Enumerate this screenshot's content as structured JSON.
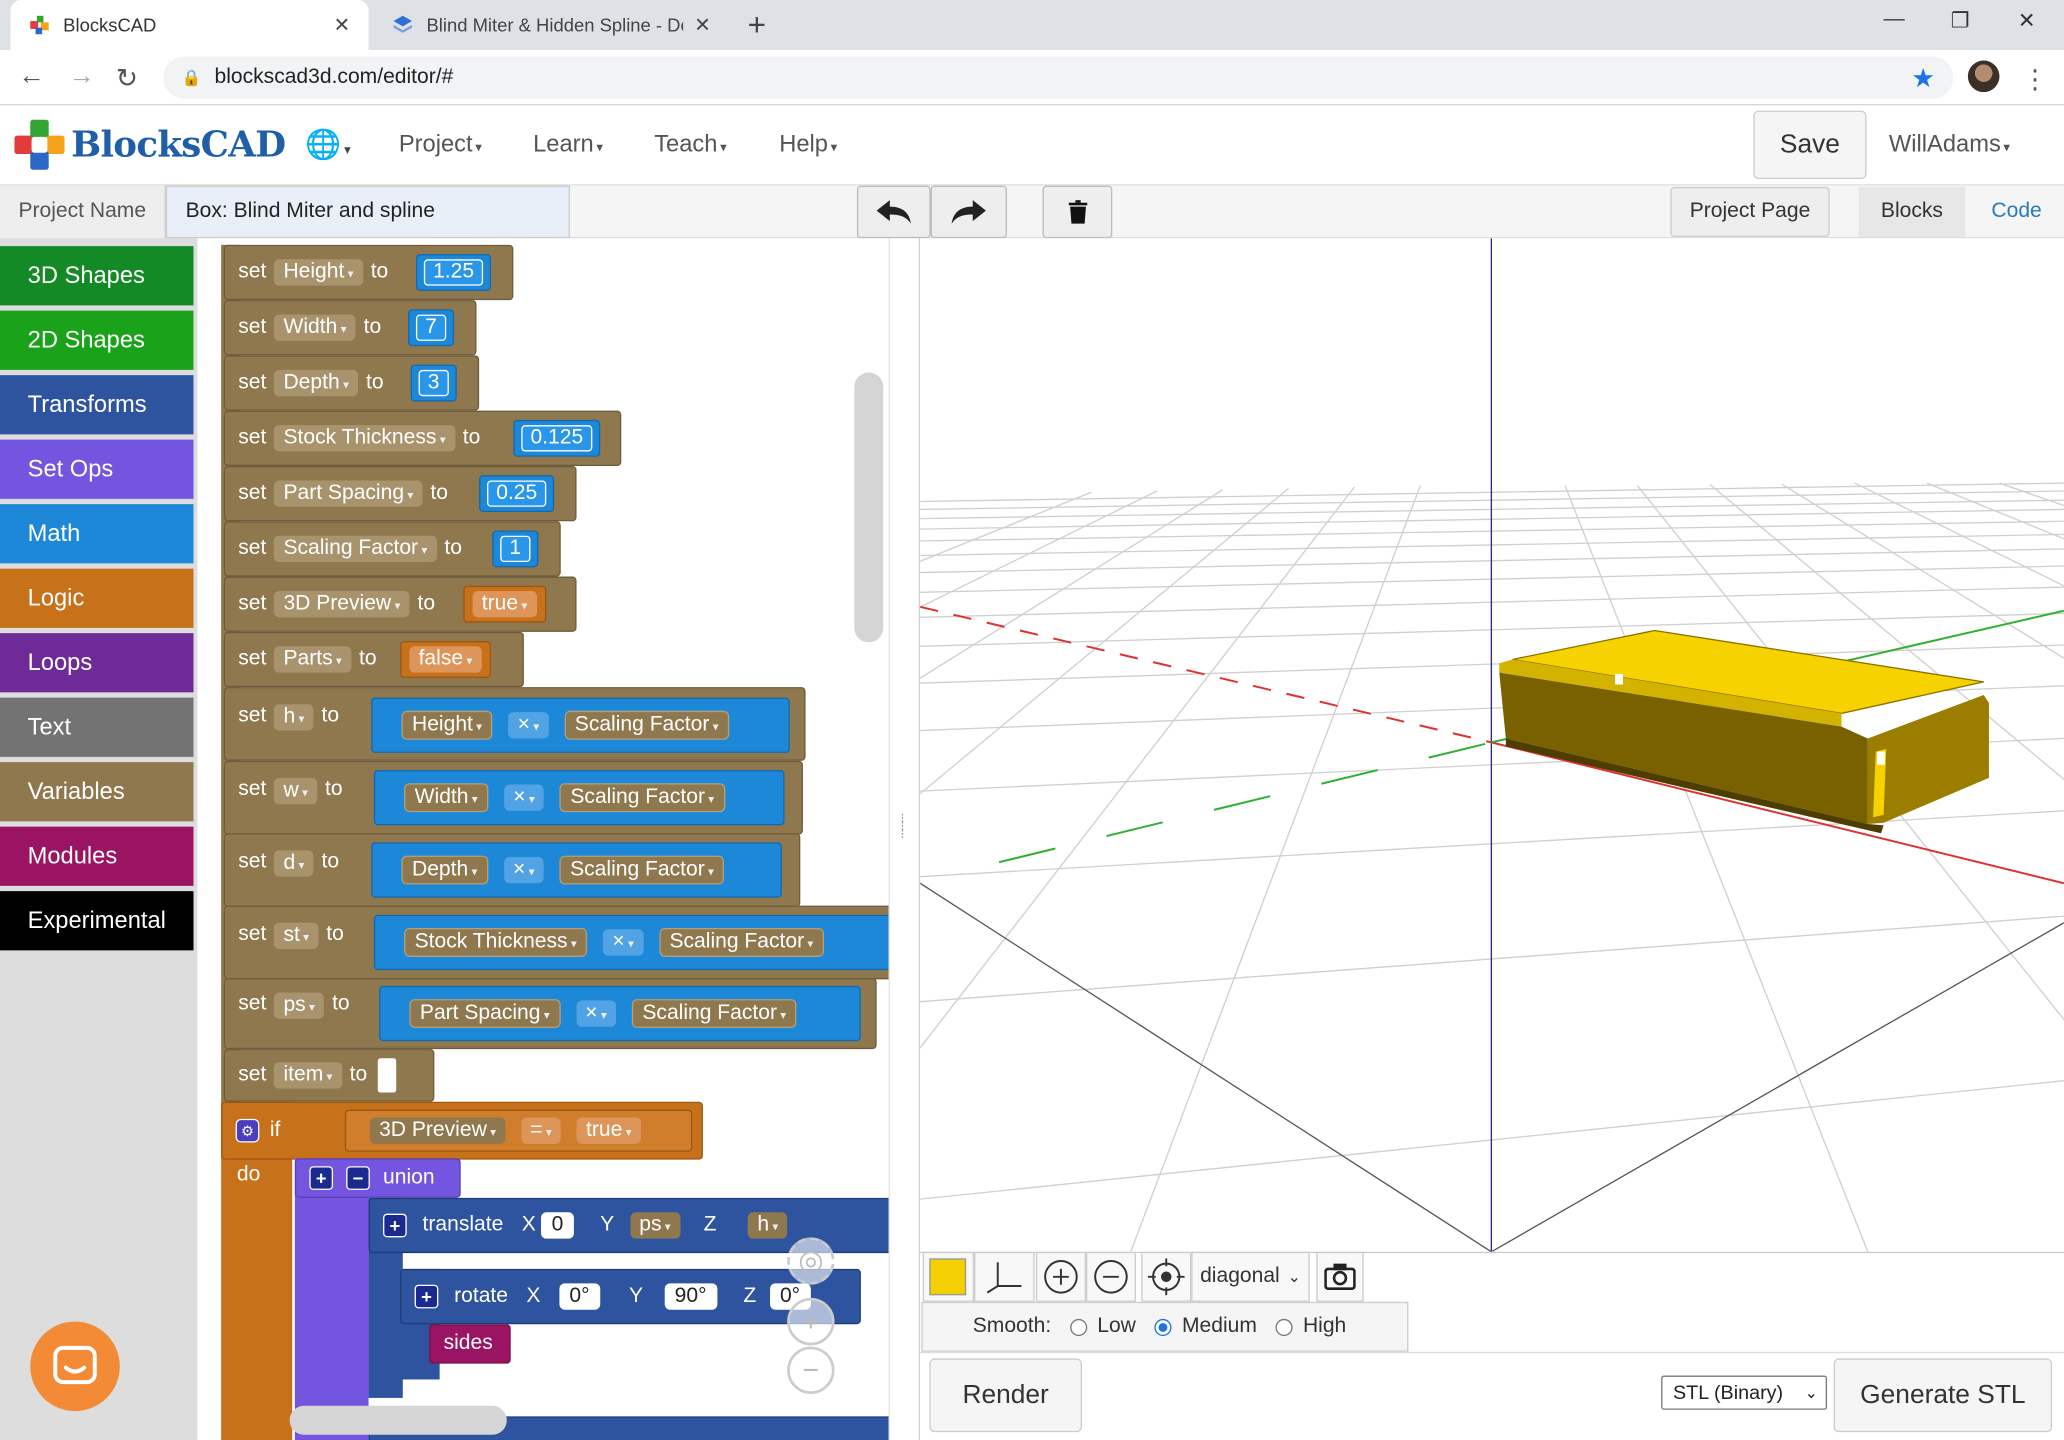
{
  "browser": {
    "tabs": [
      {
        "title": "BlocksCAD",
        "close": "✕"
      },
      {
        "title": "Blind Miter & Hidden Spline - De",
        "close": "✕"
      }
    ],
    "new_tab": "+",
    "url": "blockscad3d.com/editor/#"
  },
  "app": {
    "logo_text": "BlocksCAD",
    "menus": [
      "Project",
      "Learn",
      "Teach",
      "Help"
    ],
    "save_label": "Save",
    "user": "WillAdams"
  },
  "project": {
    "name_label": "Project Name",
    "name_value": "Box: Blind Miter and spline",
    "project_page_label": "Project Page",
    "blocks_tab": "Blocks",
    "code_tab": "Code"
  },
  "categories": [
    {
      "label": "3D Shapes",
      "color": "#138a26"
    },
    {
      "label": "2D Shapes",
      "color": "#1aa21a"
    },
    {
      "label": "Transforms",
      "color": "#2e54a0"
    },
    {
      "label": "Set Ops",
      "color": "#7455e0"
    },
    {
      "label": "Math",
      "color": "#1d87d8"
    },
    {
      "label": "Logic",
      "color": "#c7711b"
    },
    {
      "label": "Loops",
      "color": "#6e2a97"
    },
    {
      "label": "Text",
      "color": "#737373"
    },
    {
      "label": "Variables",
      "color": "#8f784e"
    },
    {
      "label": "Modules",
      "color": "#9b1463"
    },
    {
      "label": "Experimental",
      "color": "#000000"
    }
  ],
  "blocks": {
    "kw_set": "set",
    "kw_to": "to",
    "kw_if": "if",
    "kw_do": "do",
    "assigns": [
      {
        "var": "Height",
        "value": "1.25"
      },
      {
        "var": "Width",
        "value": "7"
      },
      {
        "var": "Depth",
        "value": "3"
      },
      {
        "var": "Stock Thickness",
        "value": "0.125"
      },
      {
        "var": "Part Spacing",
        "value": "0.25"
      },
      {
        "var": "Scaling Factor",
        "value": "1"
      },
      {
        "var": "3D Preview",
        "value": "true"
      },
      {
        "var": "Parts",
        "value": "false"
      }
    ],
    "products": [
      {
        "var": "h",
        "left": "Height",
        "op": "×",
        "right": "Scaling Factor"
      },
      {
        "var": "w",
        "left": "Width",
        "op": "×",
        "right": "Scaling Factor"
      },
      {
        "var": "d",
        "left": "Depth",
        "op": "×",
        "right": "Scaling Factor"
      },
      {
        "var": "st",
        "left": "Stock Thickness",
        "op": "×",
        "right": "Scaling Factor"
      },
      {
        "var": "ps",
        "left": "Part Spacing",
        "op": "×",
        "right": "Scaling Factor"
      }
    ],
    "item_var": "item",
    "if_left": "3D Preview",
    "if_op": "=",
    "if_right": "true",
    "union_label": "union",
    "translate": {
      "label": "translate",
      "x_label": "X",
      "x": "0",
      "y_label": "Y",
      "y": "ps",
      "z_label": "Z",
      "z": "h"
    },
    "rotate": {
      "label": "rotate",
      "x_label": "X",
      "x": "0°",
      "y_label": "Y",
      "y": "90°",
      "z_label": "Z",
      "z": "0°"
    },
    "module_call": "sides"
  },
  "viewer": {
    "swatch_color": "#f5d000",
    "view_select": "diagonal",
    "smooth_label": "Smooth:",
    "smooth_options": [
      "Low",
      "Medium",
      "High"
    ],
    "smooth_selected": "Medium",
    "render_label": "Render",
    "format_select": "STL (Binary)",
    "generate_label": "Generate STL"
  }
}
